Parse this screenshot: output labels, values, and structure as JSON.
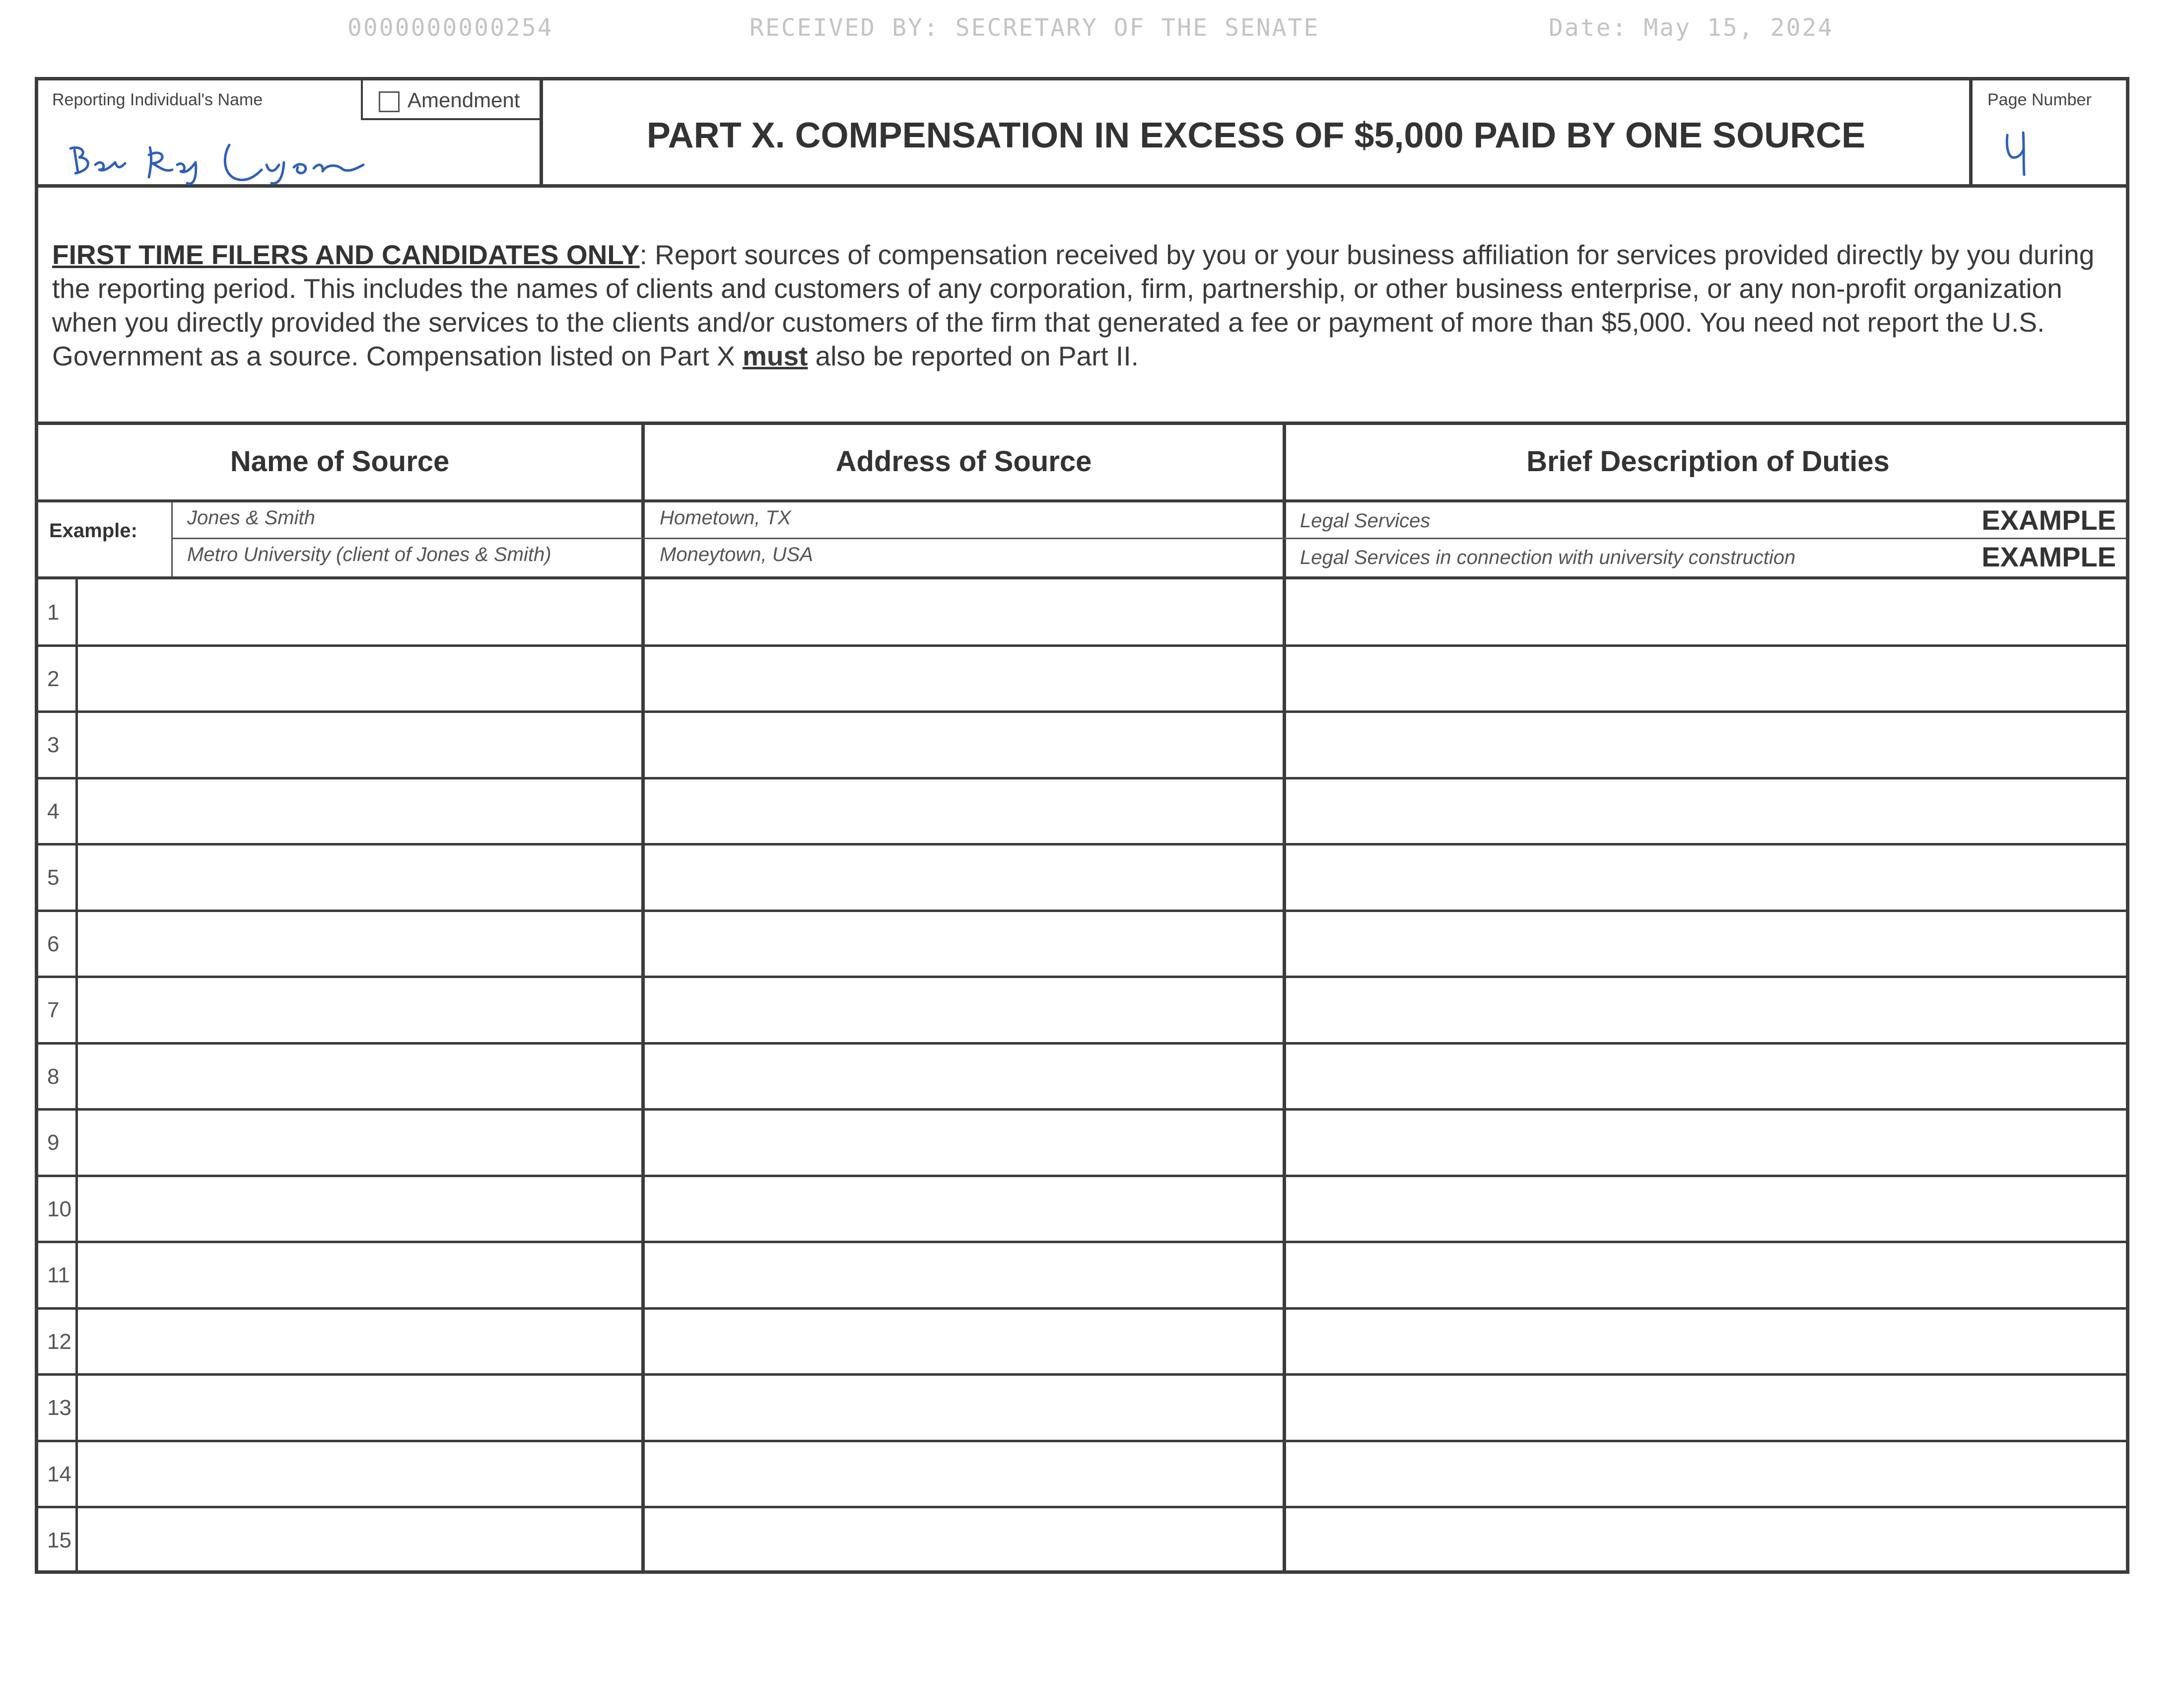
{
  "stamp": {
    "document_id": "0000000000254",
    "received_by": "RECEIVED BY: SECRETARY OF THE SENATE",
    "date": "Date: May 15, 2024"
  },
  "header": {
    "name_label": "Reporting Individual's Name",
    "amendment_label": "Amendment",
    "title": "PART X.   COMPENSATION IN EXCESS OF $5,000 PAID BY ONE SOURCE",
    "page_number_label": "Page Number",
    "signature": "Ben Ray Luján",
    "page_number": "4"
  },
  "instructions": {
    "lead": "FIRST TIME FILERS AND CANDIDATES ONLY",
    "text_part1": ": Report sources of compensation received by you or your business affiliation for services provided directly by you during the reporting period.  This includes the names of clients and customers of any corporation, firm, partnership, or other business enterprise, or any non-profit organization when you directly provided the services to the clients and/or customers of the firm that generated a fee or payment of more than $5,000.  You need not report the U.S. Government as a source.  Compensation listed on Part X ",
    "must": "must",
    "text_part2": " also be reported on Part II."
  },
  "table": {
    "columns": [
      "Name of Source",
      "Address of Source",
      "Brief Description of Duties"
    ],
    "example_label": "Example:",
    "examples": [
      {
        "name": "Jones & Smith",
        "address": "Hometown, TX",
        "duties": "Legal Services",
        "tag": "EXAMPLE"
      },
      {
        "name": "Metro University (client of Jones & Smith)",
        "address": "Moneytown, USA",
        "duties": "Legal Services in connection with university construction",
        "tag": "EXAMPLE"
      }
    ],
    "row_numbers": [
      "1",
      "2",
      "3",
      "4",
      "5",
      "6",
      "7",
      "8",
      "9",
      "10",
      "11",
      "12",
      "13",
      "14",
      "15"
    ]
  }
}
